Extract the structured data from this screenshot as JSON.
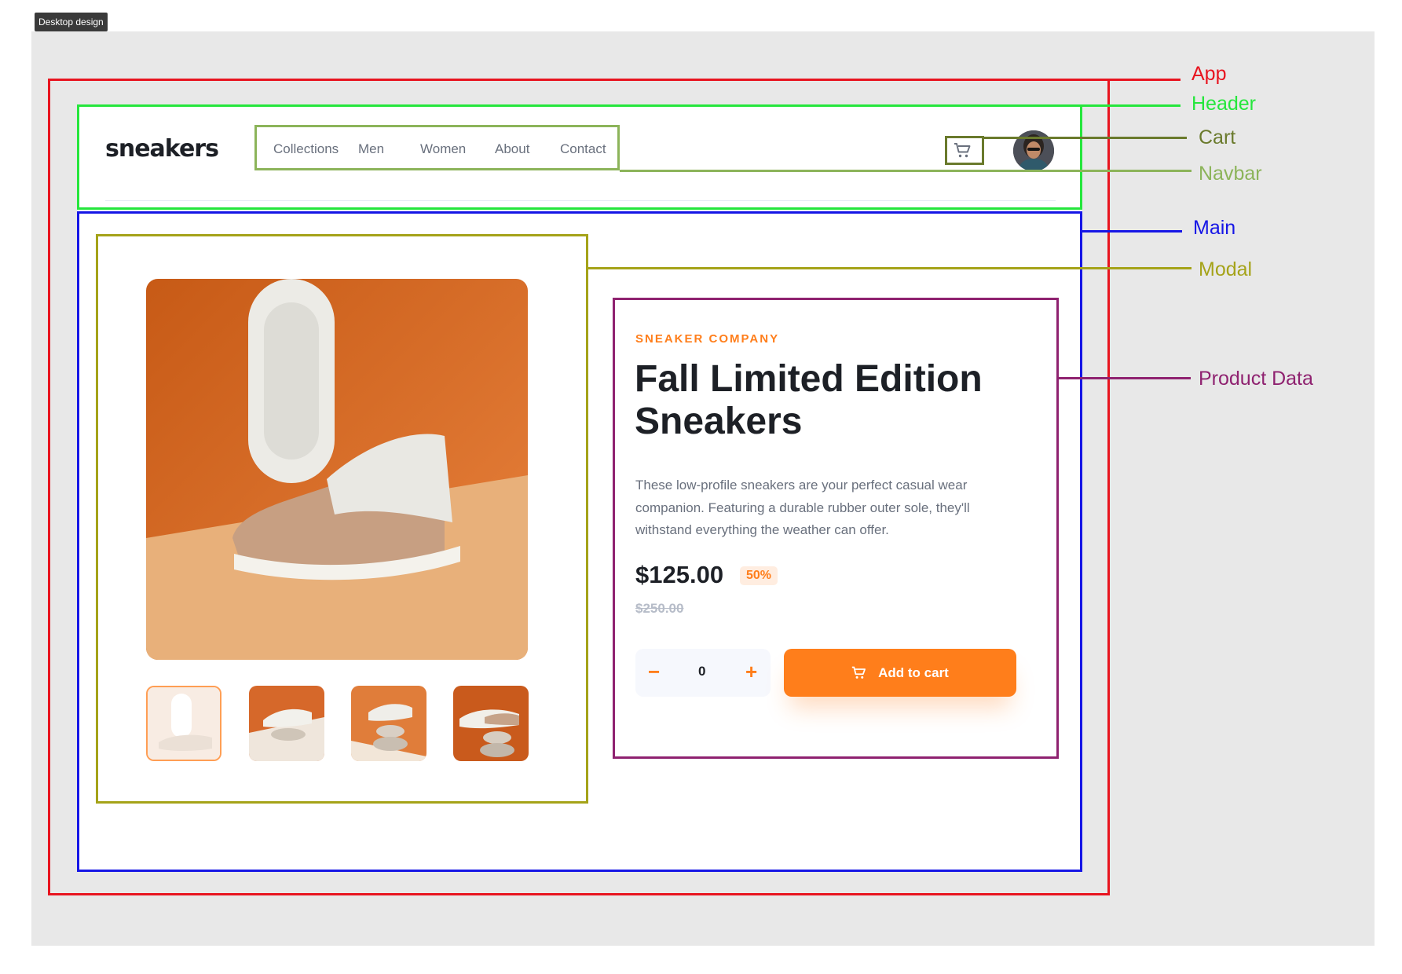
{
  "frame_label": "Desktop design",
  "annotations": {
    "app": {
      "label": "App",
      "color": "#e8141f"
    },
    "header": {
      "label": "Header",
      "color": "#25e63c"
    },
    "cart": {
      "label": "Cart",
      "color": "#6a7a2c"
    },
    "navbar": {
      "label": "Navbar",
      "color": "#8cb45a"
    },
    "main": {
      "label": "Main",
      "color": "#1616e6"
    },
    "modal": {
      "label": "Modal",
      "color": "#a5a319"
    },
    "product_data": {
      "label": "Product Data",
      "color": "#8f2270"
    }
  },
  "header": {
    "logo": "sneakers",
    "nav": [
      "Collections",
      "Men",
      "Women",
      "About",
      "Contact"
    ],
    "cart_icon": "cart-icon",
    "avatar_icon": "user-avatar"
  },
  "gallery": {
    "main_image": "sneaker-product-photo",
    "thumbnails": [
      "thumbnail-1",
      "thumbnail-2",
      "thumbnail-3",
      "thumbnail-4"
    ],
    "active_thumbnail": 1
  },
  "product": {
    "company": "SNEAKER COMPANY",
    "title": "Fall Limited Edition Sneakers",
    "description": "These low-profile sneakers are your perfect casual wear companion. Featuring a durable rubber outer sole, they'll withstand everything the weather can offer.",
    "price": "$125.00",
    "discount": "50%",
    "original_price": "$250.00",
    "quantity": "0",
    "minus": "−",
    "plus": "+",
    "add_to_cart": "Add to cart"
  },
  "colors": {
    "accent": "#ff7e1b",
    "accent_pale": "#ffede0",
    "text_dark": "#1d2026",
    "text_grey": "#69707d"
  }
}
